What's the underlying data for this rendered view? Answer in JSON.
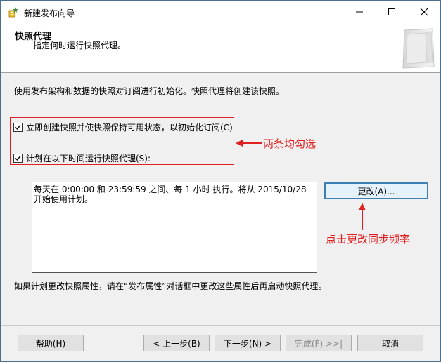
{
  "window": {
    "title": "新建发布向导"
  },
  "header": {
    "title": "快照代理",
    "subtitle": "指定何时运行快照代理。"
  },
  "main": {
    "description": "使用发布架构和数据的快照对订阅进行初始化。快照代理将创建该快照。",
    "checkbox_immediate": {
      "label": "立即创建快照并使快照保持可用状态，以初始化订阅(C)",
      "checked": true
    },
    "checkbox_schedule": {
      "label": "计划在以下时间运行快照代理(S):",
      "checked": true
    },
    "schedule_text": "每天在 0:00:00 和 23:59:59 之间、每 1 小时 执行。将从 2015/10/28 开始使用计划。",
    "change_button": "更改(A)...",
    "footer_note": "如果计划更改快照属性，请在“发布属性”对话框中更改这些属性后再启动快照代理。"
  },
  "annotations": {
    "check_both": "两条均勾选",
    "click_change": "点击更改同步频率",
    "color": "#e02020"
  },
  "buttons": {
    "help": "帮助(H)",
    "back": "< 上一步(B)",
    "next": "下一步(N) >",
    "finish": "完成(F) >>|",
    "cancel": "取消"
  }
}
